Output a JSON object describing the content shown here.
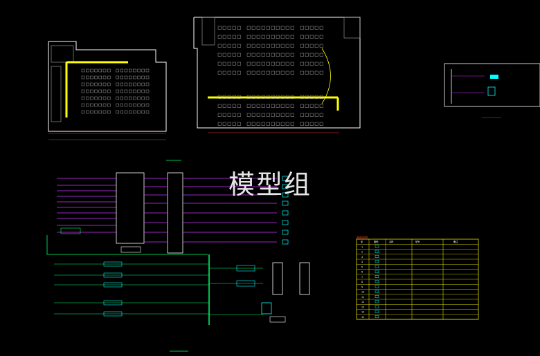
{
  "watermark": "模型组",
  "legend_table": {
    "title": "图例说明",
    "headers": [
      "序",
      "图例",
      "名称",
      "型号",
      "备注"
    ],
    "rows": [
      {
        "no": "1"
      },
      {
        "no": "2"
      },
      {
        "no": "3"
      },
      {
        "no": "4"
      },
      {
        "no": "5"
      },
      {
        "no": "6"
      },
      {
        "no": "7"
      },
      {
        "no": "8"
      },
      {
        "no": "9"
      },
      {
        "no": "10"
      },
      {
        "no": "11"
      },
      {
        "no": "12"
      },
      {
        "no": "13"
      },
      {
        "no": "14"
      },
      {
        "no": "15"
      }
    ]
  },
  "colors": {
    "background": "#000000",
    "wall": "#ffffff",
    "seat": "#c8c8c8",
    "cable_tray": "#ffff00",
    "device": "#00ffff",
    "signal_line": "#cc33ff",
    "power_line": "#00ff66",
    "label": "#ffff66",
    "note": "#ff3333",
    "table_grid": "#ffff00"
  }
}
